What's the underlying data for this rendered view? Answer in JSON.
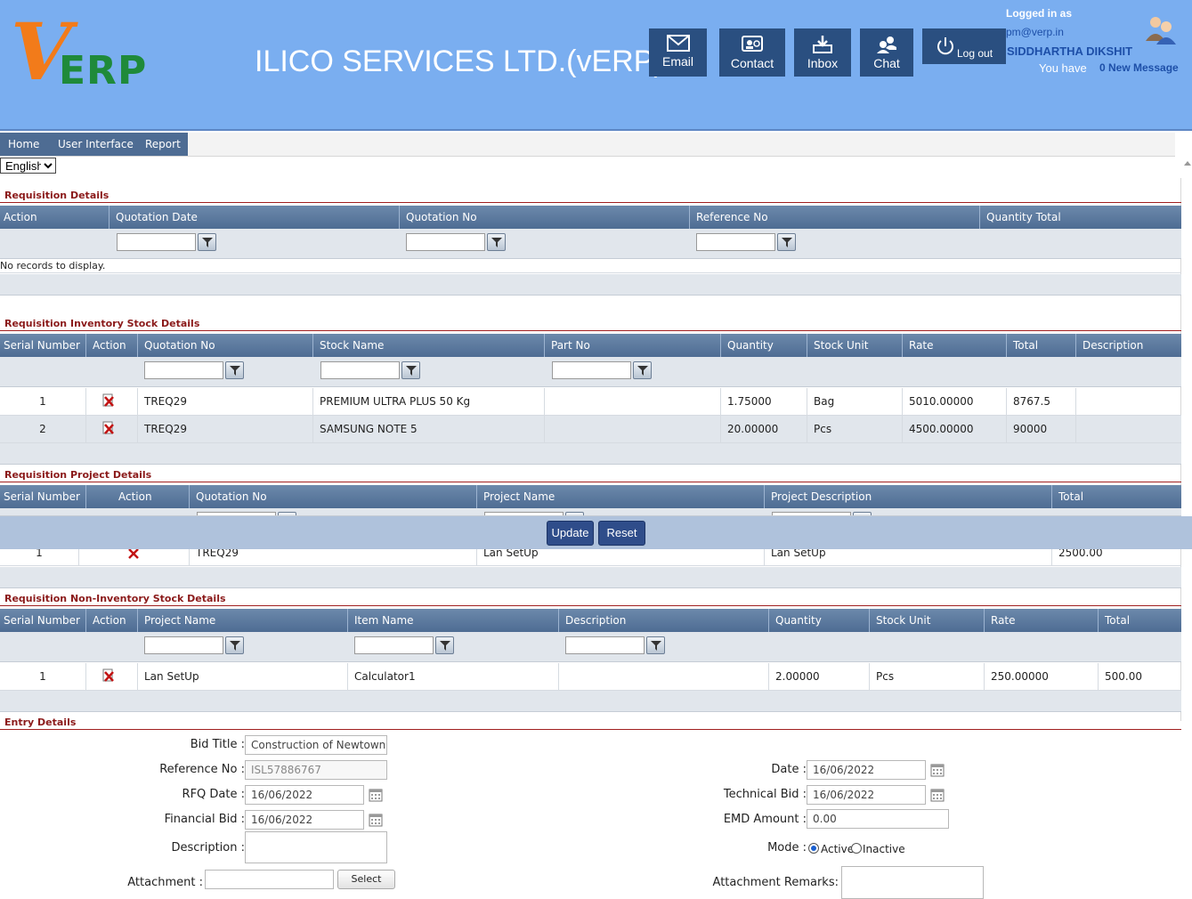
{
  "header": {
    "logo_v": "V",
    "logo_erp": "ERP",
    "company": "ILICO SERVICES LTD.(vERP)",
    "buttons": [
      "Email",
      "Contact",
      "Inbox",
      "Chat"
    ],
    "logout": "Log out",
    "logged_in_as": "Logged in as",
    "email": "pm@verp.in",
    "user": "SIDDHARTHA DIKSHIT",
    "you_have": "You have",
    "new_message": "0 New Message"
  },
  "menu": [
    "Home",
    "User Interface",
    "Report"
  ],
  "language": "English",
  "req_details": {
    "title": "Requisition Details",
    "columns": [
      "Action",
      "Quotation Date",
      "Quotation No",
      "Reference No",
      "Quantity Total"
    ],
    "empty": "No records to display."
  },
  "inv_stock": {
    "title": "Requisition Inventory Stock Details",
    "columns": [
      "Serial Number",
      "Action",
      "Quotation No",
      "Stock Name",
      "Part No",
      "Quantity",
      "Stock Unit",
      "Rate",
      "Total",
      "Description"
    ],
    "rows": [
      [
        "1",
        "TREQ29",
        "PREMIUM ULTRA PLUS 50 Kg",
        "",
        "1.75000",
        "Bag",
        "5010.00000",
        "8767.5",
        ""
      ],
      [
        "2",
        "TREQ29",
        "SAMSUNG NOTE 5",
        "",
        "20.00000",
        "Pcs",
        "4500.00000",
        "90000",
        ""
      ]
    ]
  },
  "project": {
    "title": "Requisition Project Details",
    "columns": [
      "Serial Number",
      "Action",
      "Quotation No",
      "Project Name",
      "Project Description",
      "Total"
    ],
    "rows": [
      [
        "1",
        "TREQ29",
        "Lan SetUp",
        "Lan SetUp",
        "2500.00"
      ]
    ]
  },
  "actions": {
    "update": "Update",
    "reset": "Reset"
  },
  "non_inv": {
    "title": "Requisition Non-Inventory Stock Details",
    "columns": [
      "Serial Number",
      "Action",
      "Project Name",
      "Item Name",
      "Description",
      "Quantity",
      "Stock Unit",
      "Rate",
      "Total"
    ],
    "rows": [
      [
        "1",
        "Lan SetUp",
        "Calculator1",
        "",
        "2.00000",
        "Pcs",
        "250.00000",
        "500.00"
      ]
    ]
  },
  "entry": {
    "title": "Entry Details",
    "bid_title_label": "Bid Title :",
    "bid_title": "Construction of Newtown of",
    "ref_label": "Reference No :",
    "ref": "ISL57886767",
    "rfq_label": "RFQ Date :",
    "rfq": "16/06/2022",
    "fin_label": "Financial Bid :",
    "fin": "16/06/2022",
    "desc_label": "Description :",
    "attach_label": "Attachment :",
    "select": "Select",
    "date_label": "Date :",
    "date": "16/06/2022",
    "tech_label": "Technical Bid :",
    "tech": "16/06/2022",
    "emd_label": "EMD Amount :",
    "emd": "0.00",
    "mode_label": "Mode :",
    "active": "Active",
    "inactive": "Inactive",
    "attach_remarks_label": "Attachment Remarks:"
  }
}
